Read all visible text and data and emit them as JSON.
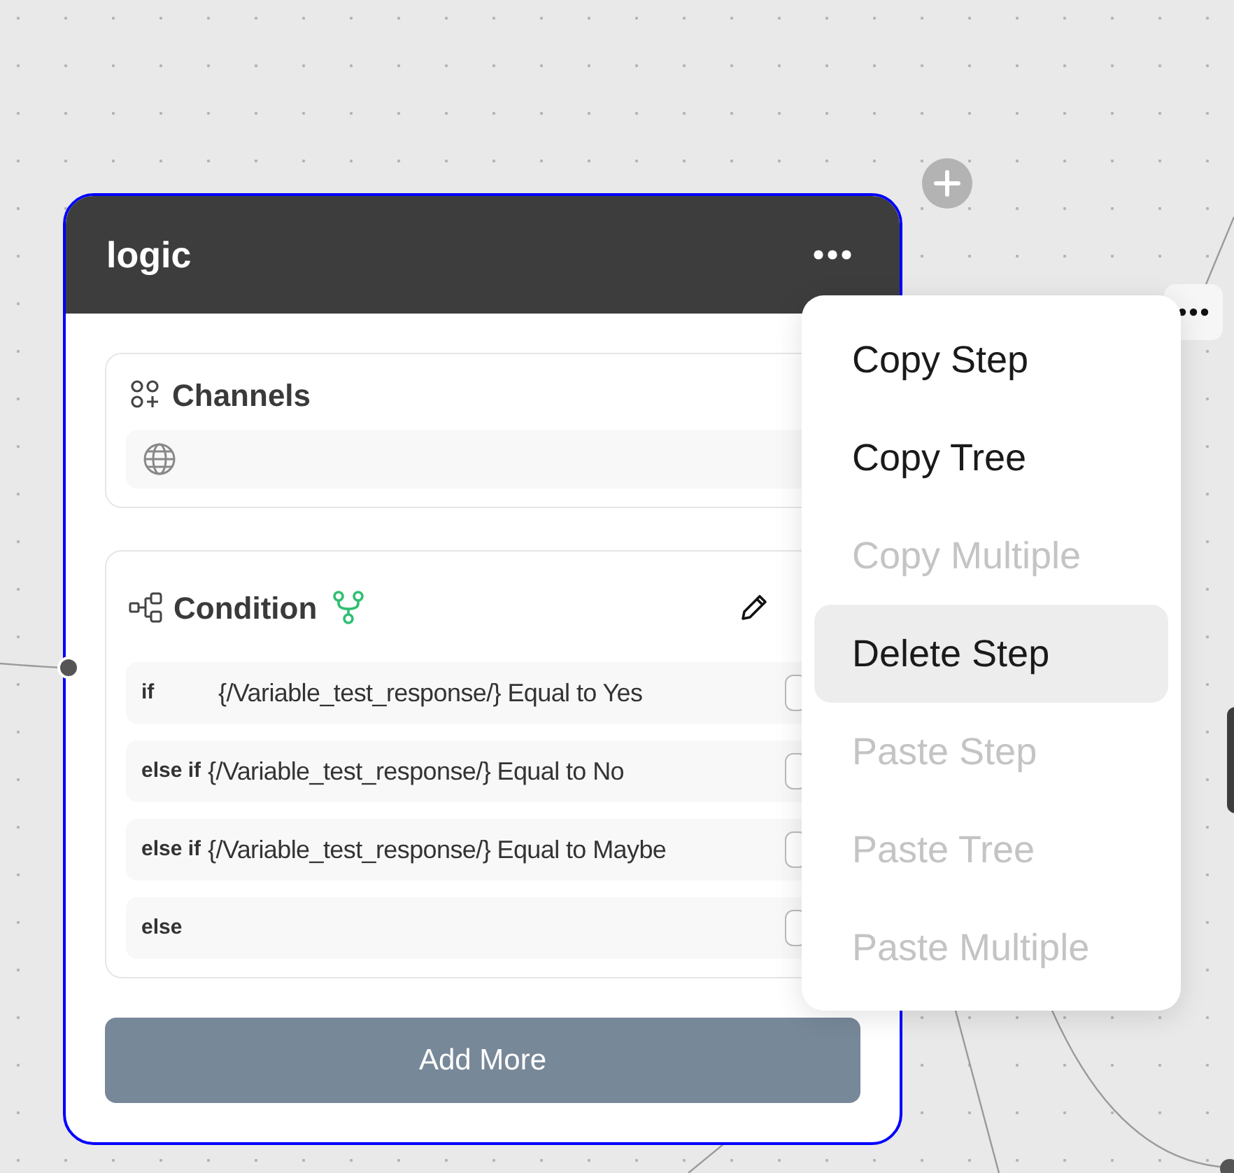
{
  "node": {
    "title": "logic",
    "channels": {
      "label": "Channels"
    },
    "condition": {
      "label": "Condition",
      "rows": [
        {
          "kind": "if",
          "label": "if",
          "expression": "{/Variable_test_response/} Equal to Yes"
        },
        {
          "kind": "else_if",
          "label": "else if",
          "expression": "{/Variable_test_response/} Equal to No"
        },
        {
          "kind": "else_if",
          "label": "else if",
          "expression": "{/Variable_test_response/} Equal to Maybe"
        },
        {
          "kind": "else",
          "label": "else"
        }
      ]
    },
    "button": "Add More"
  },
  "menu": [
    {
      "label": "Copy Step",
      "disabled": false,
      "selected": false
    },
    {
      "label": "Copy Tree",
      "disabled": false,
      "selected": false
    },
    {
      "label": "Copy Multiple",
      "disabled": true,
      "selected": false
    },
    {
      "label": "Delete Step",
      "disabled": false,
      "selected": true
    },
    {
      "label": "Paste Step",
      "disabled": true,
      "selected": false
    },
    {
      "label": "Paste Tree",
      "disabled": true,
      "selected": false
    },
    {
      "label": "Paste Multiple",
      "disabled": true,
      "selected": false
    }
  ]
}
